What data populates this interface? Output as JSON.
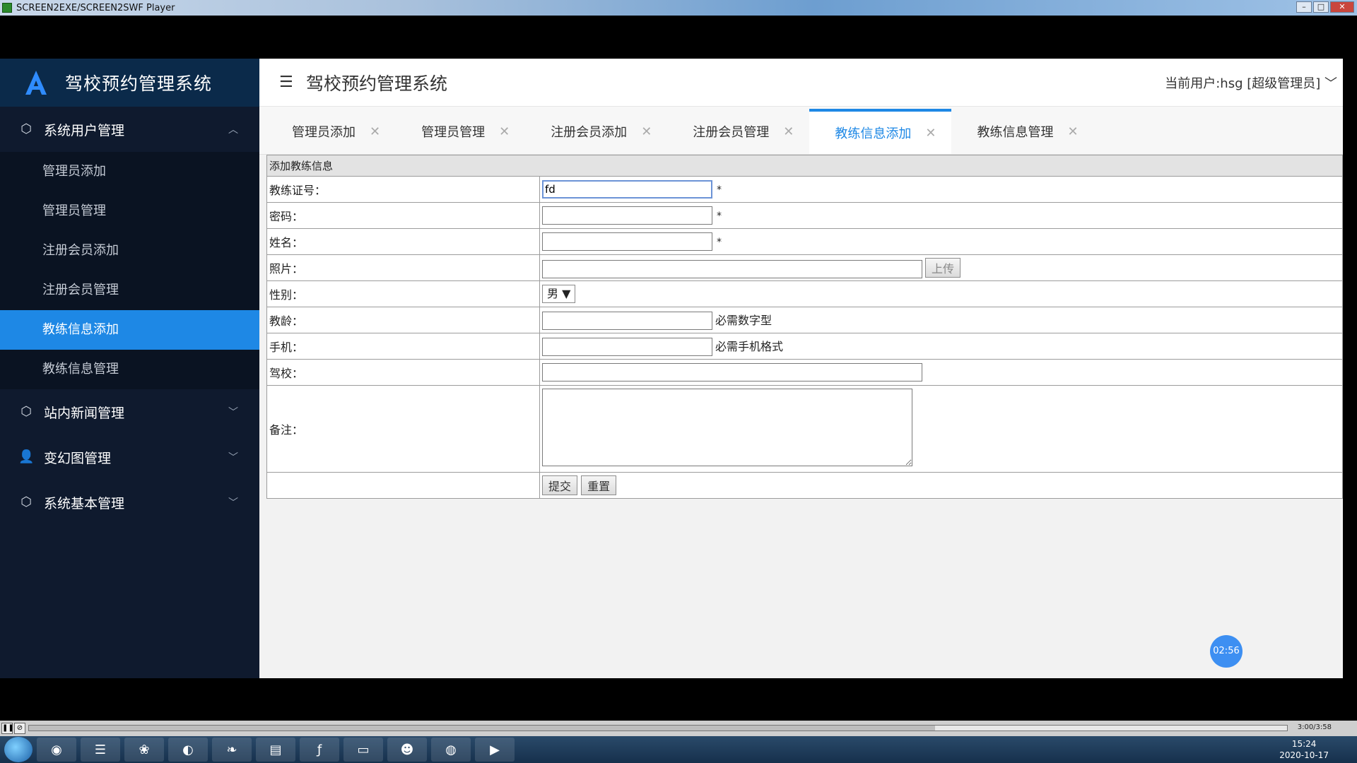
{
  "player": {
    "title": "SCREEN2EXE/SCREEN2SWF Player",
    "time_label": "3:00/3:58",
    "progress": 0.72
  },
  "sidebar": {
    "brand": "驾校预约管理系统",
    "groups": [
      {
        "label": "系统用户管理",
        "icon": "cube-icon",
        "expanded": true,
        "items": [
          {
            "label": "管理员添加"
          },
          {
            "label": "管理员管理"
          },
          {
            "label": "注册会员添加"
          },
          {
            "label": "注册会员管理"
          },
          {
            "label": "教练信息添加",
            "active": true
          },
          {
            "label": "教练信息管理"
          }
        ]
      },
      {
        "label": "站内新闻管理",
        "icon": "cube-icon"
      },
      {
        "label": "变幻图管理",
        "icon": "user-icon"
      },
      {
        "label": "系统基本管理",
        "icon": "cube-icon"
      }
    ]
  },
  "header": {
    "title": "驾校预约管理系统",
    "user": "当前用户:hsg [超级管理员]"
  },
  "tabs": [
    {
      "label": "管理员添加"
    },
    {
      "label": "管理员管理"
    },
    {
      "label": "注册会员添加"
    },
    {
      "label": "注册会员管理"
    },
    {
      "label": "教练信息添加",
      "active": true
    },
    {
      "label": "教练信息管理"
    }
  ],
  "form": {
    "heading": "添加教练信息",
    "coach_no_label": "教练证号：",
    "coach_no_value": "fd",
    "password_label": "密码：",
    "name_label": "姓名：",
    "photo_label": "照片：",
    "upload_label": "上传",
    "gender_label": "性别：",
    "gender_value": "男",
    "age_label": "教龄：",
    "age_hint": "必需数字型",
    "phone_label": "手机：",
    "phone_hint": "必需手机格式",
    "school_label": "驾校：",
    "remark_label": "备注：",
    "required_mark": "*",
    "submit_label": "提交",
    "reset_label": "重置"
  },
  "timer_badge": "02:56",
  "taskbar": {
    "time": "15:24",
    "date": "2020-10-17"
  },
  "colors": {
    "accent": "#1e88e5",
    "sidebar_bg": "#0f1a2e"
  }
}
